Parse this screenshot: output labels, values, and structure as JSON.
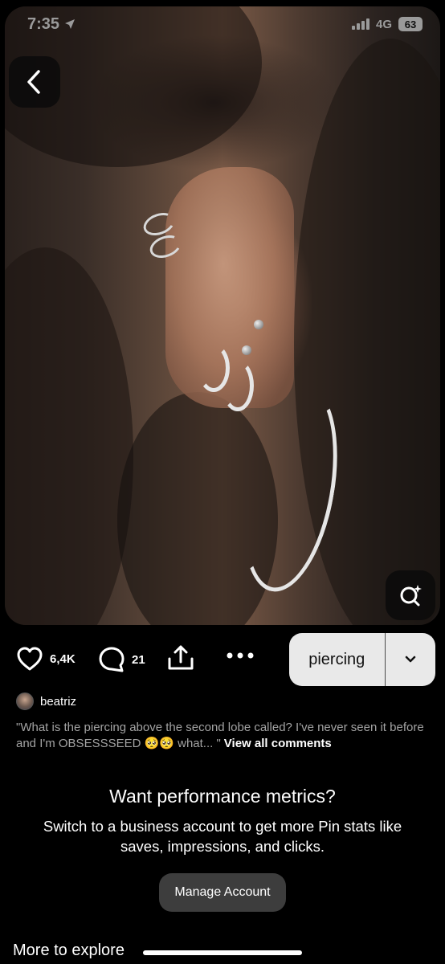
{
  "status_bar": {
    "time": "7:35",
    "network": "4G",
    "battery": "63"
  },
  "pin": {
    "image_alt": "",
    "back_icon": "chevron-left-icon",
    "visual_search_icon": "visual-search-icon"
  },
  "actions": {
    "likes": "6,4K",
    "comments": "21",
    "share_icon": "share-icon",
    "more_icon": "more-icon",
    "board_name": "piercing",
    "board_chevron_icon": "chevron-down-icon"
  },
  "creator": {
    "name": "beatriz"
  },
  "top_comment": {
    "text": "\"What is the piercing above the second lobe called? I've never seen it before and I'm OBSESSSEED 🥺🥺 what... \"",
    "view_all": "View all comments"
  },
  "promo": {
    "title": "Want performance metrics?",
    "body": "Switch to a business account to get more Pin stats like saves, impressions, and clicks.",
    "button": "Manage Account"
  },
  "explore": {
    "title": "More to explore"
  },
  "colors": {
    "background": "#000000",
    "board_button_bg": "#e9e9e9",
    "secondary_button_bg": "#3d3d3d",
    "muted_text": "#a3a3a3"
  }
}
